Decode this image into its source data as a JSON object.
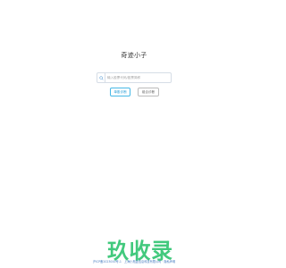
{
  "site": {
    "title": "奇迹小子"
  },
  "search": {
    "icon": "search-icon",
    "placeholder": "输入股票代码/股票简称"
  },
  "buttons": {
    "primary_label": "单股诊断",
    "secondary_label": "组合诊断"
  },
  "watermark": {
    "text": "玖收录"
  },
  "footer": {
    "icp": "沪ICP备2023000号-1",
    "company": "上海小瓶盖信息科技有限公司 · 隐私声明"
  },
  "colors": {
    "primary": "#2a9ed6",
    "watermark": "#2ec46f",
    "footer_link": "#4a7fc1"
  }
}
